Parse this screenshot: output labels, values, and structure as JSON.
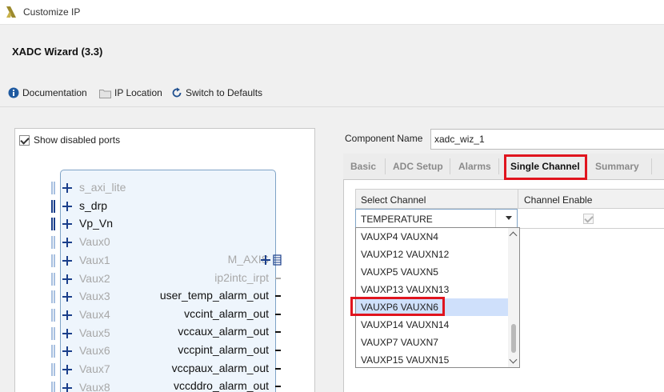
{
  "window": {
    "title": "Customize IP"
  },
  "header": {
    "title": "XADC Wizard (3.3)"
  },
  "toolbar": {
    "documentation": "Documentation",
    "ip_location": "IP Location",
    "switch_defaults": "Switch to Defaults"
  },
  "left_panel": {
    "show_disabled_ports": "Show disabled ports",
    "left_ports": [
      {
        "label": "s_axi_lite",
        "enabled": false
      },
      {
        "label": "s_drp",
        "enabled": true
      },
      {
        "label": "Vp_Vn",
        "enabled": true
      },
      {
        "label": "Vaux0",
        "enabled": false
      },
      {
        "label": "Vaux1",
        "enabled": false
      },
      {
        "label": "Vaux2",
        "enabled": false
      },
      {
        "label": "Vaux3",
        "enabled": false
      },
      {
        "label": "Vaux4",
        "enabled": false
      },
      {
        "label": "Vaux5",
        "enabled": false
      },
      {
        "label": "Vaux6",
        "enabled": false
      },
      {
        "label": "Vaux7",
        "enabled": false
      },
      {
        "label": "Vaux8",
        "enabled": false
      }
    ],
    "right_ports": [
      {
        "label": "M_AXIS",
        "enabled": false
      },
      {
        "label": "ip2intc_irpt",
        "enabled": false
      },
      {
        "label": "user_temp_alarm_out",
        "enabled": true
      },
      {
        "label": "vccint_alarm_out",
        "enabled": true
      },
      {
        "label": "vccaux_alarm_out",
        "enabled": true
      },
      {
        "label": "vccpint_alarm_out",
        "enabled": true
      },
      {
        "label": "vccpaux_alarm_out",
        "enabled": true
      },
      {
        "label": "vccddro_alarm_out",
        "enabled": true
      }
    ]
  },
  "component": {
    "label": "Component Name",
    "value": "xadc_wiz_1"
  },
  "tabs": [
    "Basic",
    "ADC Setup",
    "Alarms",
    "Single Channel",
    "Summary"
  ],
  "active_tab": "Single Channel",
  "table": {
    "headers": [
      "Select Channel",
      "Channel Enable"
    ],
    "selected_channel": "TEMPERATURE",
    "channel_enabled": true
  },
  "dropdown": {
    "options": [
      "VAUXP4 VAUXN4",
      "VAUXP12 VAUXN12",
      "VAUXP5 VAUXN5",
      "VAUXP13 VAUXN13",
      "VAUXP6 VAUXN6",
      "VAUXP14 VAUXN14",
      "VAUXP7 VAUXN7",
      "VAUXP15 VAUXN15"
    ],
    "highlighted": "VAUXP6 VAUXN6"
  },
  "colors": {
    "highlight_box": "#e0141e",
    "selection": "#cfe0fb",
    "port_blue": "#1b3f8b"
  }
}
